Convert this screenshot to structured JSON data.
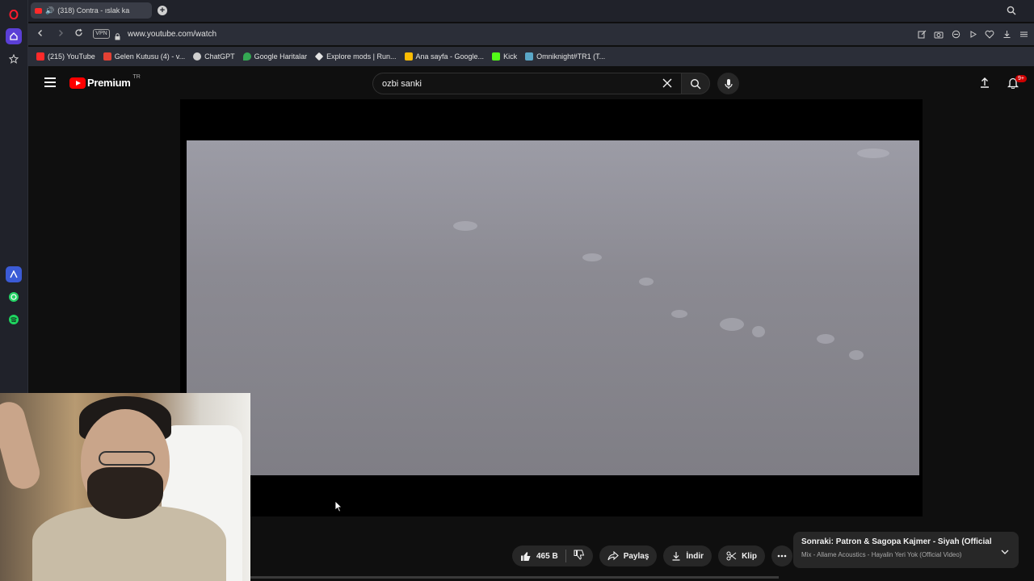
{
  "browser": {
    "tab": {
      "title": "(318) Contra - ıslak ka"
    },
    "address": {
      "vpn_label": "VPN",
      "url": "www.youtube.com/watch"
    },
    "bookmarks": [
      {
        "label": "(215) YouTube",
        "color": "#ff2a2a"
      },
      {
        "label": "Gelen Kutusu (4) - v...",
        "color": "#e44134"
      },
      {
        "label": "ChatGPT",
        "color": "#cfcfcf"
      },
      {
        "label": "Google Haritalar",
        "color": "#34a853"
      },
      {
        "label": "Explore mods | Run...",
        "color": "#e4e4e4"
      },
      {
        "label": "Ana sayfa - Google...",
        "color": "#fbbc04"
      },
      {
        "label": "Kick",
        "color": "#53fc18"
      },
      {
        "label": "Omniknight#TR1 (T...",
        "color": "#5aa7c7"
      }
    ]
  },
  "youtube": {
    "logo_text": "Premium",
    "country_code": "TR",
    "search_query": "ozbi sanki",
    "notification_count": "9+",
    "actions": {
      "likes": "465 B",
      "share": "Paylaş",
      "download": "İndir",
      "clip": "Klip"
    },
    "next_up": {
      "title": "Sonraki: Patron & Sagopa Kajmer - Siyah (Official Vi...",
      "subtitle": "Mix - Allame Acoustics - Hayalin Yeri Yok (Official Video)"
    }
  },
  "colors": {
    "accent": "#ff0000",
    "badge": "#cc0000"
  }
}
